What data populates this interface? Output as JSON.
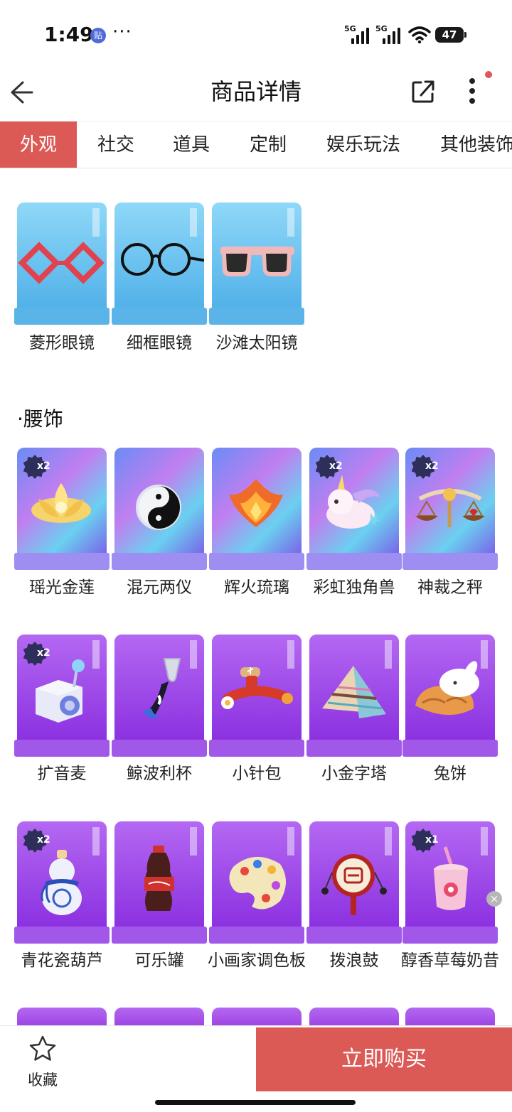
{
  "status_bar": {
    "time": "1:49",
    "app_badge": "贴",
    "dots": "···",
    "signal1": "5G",
    "signal2": "5G",
    "battery": "47"
  },
  "header": {
    "title": "商品详情",
    "icons": [
      "back-arrow-icon",
      "share-icon",
      "more-vertical-icon"
    ]
  },
  "tabs": [
    {
      "label": "外观",
      "active": true
    },
    {
      "label": "社交",
      "active": false
    },
    {
      "label": "道具",
      "active": false
    },
    {
      "label": "定制",
      "active": false
    },
    {
      "label": "娱乐玩法",
      "active": false
    },
    {
      "label": "其他装饰",
      "active": false
    }
  ],
  "glasses": {
    "items": [
      {
        "label": "菱形眼镜"
      },
      {
        "label": "细框眼镜"
      },
      {
        "label": "沙滩太阳镜"
      }
    ]
  },
  "waist": {
    "title": "·腰饰",
    "rows": [
      [
        {
          "label": "瑶光金莲",
          "badge": "x2"
        },
        {
          "label": "混元两仪",
          "badge": ""
        },
        {
          "label": "辉火琉璃",
          "badge": ""
        },
        {
          "label": "彩虹独角兽",
          "badge": "x2"
        },
        {
          "label": "神裁之秤",
          "badge": "x2"
        }
      ],
      [
        {
          "label": "扩音麦",
          "badge": "x2"
        },
        {
          "label": "鲸波利杯",
          "badge": ""
        },
        {
          "label": "小针包",
          "badge": ""
        },
        {
          "label": "小金字塔",
          "badge": ""
        },
        {
          "label": "兔饼",
          "badge": ""
        }
      ],
      [
        {
          "label": "青花瓷葫芦",
          "badge": "x2"
        },
        {
          "label": "可乐罐",
          "badge": ""
        },
        {
          "label": "小画家调色板",
          "badge": ""
        },
        {
          "label": "拨浪鼓",
          "badge": ""
        },
        {
          "label": "醇香草莓奶昔",
          "badge": "x1"
        }
      ]
    ]
  },
  "bottom": {
    "favorite_label": "收藏",
    "buy_label": "立即购买"
  },
  "colors": {
    "accent": "#dc5a55",
    "glasses_card": "#5ab7ea",
    "holo_card": "#8a6cf0",
    "purple_card": "#9a3fe0"
  }
}
